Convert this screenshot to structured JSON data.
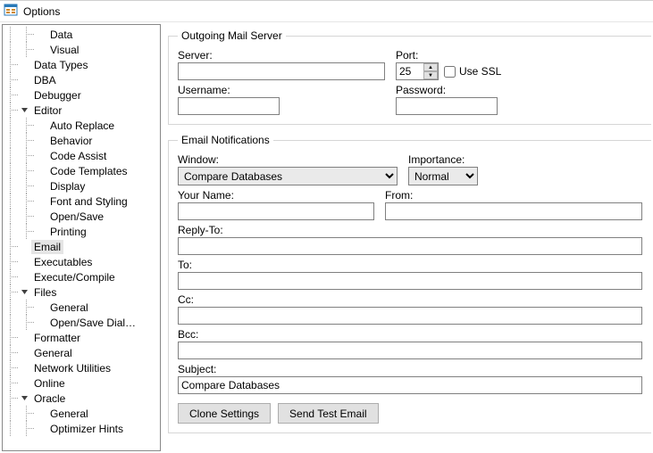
{
  "window": {
    "title": "Options"
  },
  "tree": {
    "items": [
      {
        "label": "Data",
        "depth": 2,
        "expand": null
      },
      {
        "label": "Visual",
        "depth": 2,
        "expand": null
      },
      {
        "label": "Data Types",
        "depth": 1,
        "expand": null
      },
      {
        "label": "DBA",
        "depth": 1,
        "expand": null
      },
      {
        "label": "Debugger",
        "depth": 1,
        "expand": null
      },
      {
        "label": "Editor",
        "depth": 1,
        "expand": "open"
      },
      {
        "label": "Auto Replace",
        "depth": 2,
        "expand": null
      },
      {
        "label": "Behavior",
        "depth": 2,
        "expand": null
      },
      {
        "label": "Code Assist",
        "depth": 2,
        "expand": null
      },
      {
        "label": "Code Templates",
        "depth": 2,
        "expand": null
      },
      {
        "label": "Display",
        "depth": 2,
        "expand": null
      },
      {
        "label": "Font and Styling",
        "depth": 2,
        "expand": null
      },
      {
        "label": "Open/Save",
        "depth": 2,
        "expand": null
      },
      {
        "label": "Printing",
        "depth": 2,
        "expand": null
      },
      {
        "label": "Email",
        "depth": 1,
        "expand": null,
        "selected": true
      },
      {
        "label": "Executables",
        "depth": 1,
        "expand": null
      },
      {
        "label": "Execute/Compile",
        "depth": 1,
        "expand": null
      },
      {
        "label": "Files",
        "depth": 1,
        "expand": "open"
      },
      {
        "label": "General",
        "depth": 2,
        "expand": null
      },
      {
        "label": "Open/Save Dial…",
        "depth": 2,
        "expand": null
      },
      {
        "label": "Formatter",
        "depth": 1,
        "expand": null
      },
      {
        "label": "General",
        "depth": 1,
        "expand": null
      },
      {
        "label": "Network Utilities",
        "depth": 1,
        "expand": null
      },
      {
        "label": "Online",
        "depth": 1,
        "expand": null
      },
      {
        "label": "Oracle",
        "depth": 1,
        "expand": "open"
      },
      {
        "label": "General",
        "depth": 2,
        "expand": null
      },
      {
        "label": "Optimizer Hints",
        "depth": 2,
        "expand": null
      }
    ]
  },
  "outgoing": {
    "legend": "Outgoing Mail Server",
    "server_label": "Server:",
    "server_value": "",
    "port_label": "Port:",
    "port_value": "25",
    "usessl_label": "Use SSL",
    "usessl_checked": false,
    "username_label": "Username:",
    "username_value": "",
    "password_label": "Password:",
    "password_value": ""
  },
  "notif": {
    "legend": "Email Notifications",
    "window_label": "Window:",
    "window_value": "Compare Databases",
    "importance_label": "Importance:",
    "importance_value": "Normal",
    "yourname_label": "Your Name:",
    "yourname_value": "",
    "from_label": "From:",
    "from_value": "",
    "replyto_label": "Reply-To:",
    "replyto_value": "",
    "to_label": "To:",
    "to_value": "",
    "cc_label": "Cc:",
    "cc_value": "",
    "bcc_label": "Bcc:",
    "bcc_value": "",
    "subject_label": "Subject:",
    "subject_value": "Compare Databases",
    "clone_label": "Clone Settings",
    "sendtest_label": "Send Test Email"
  }
}
